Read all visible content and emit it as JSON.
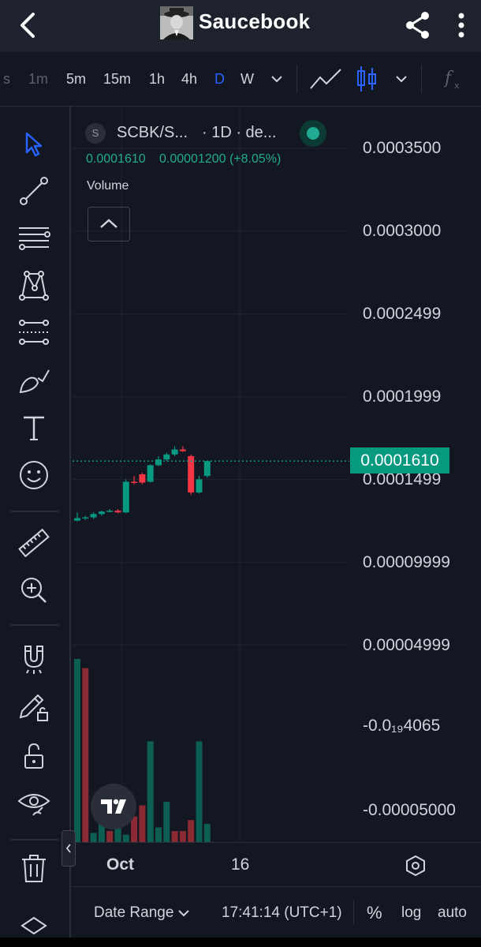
{
  "header": {
    "title": "Saucebook"
  },
  "timeframes": {
    "partial": "s",
    "items": [
      "1m",
      "5m",
      "15m",
      "1h",
      "4h",
      "D",
      "W"
    ],
    "active": "D"
  },
  "legend": {
    "symbol_initial": "S",
    "symbol": "SCBK/S...",
    "interval": "· 1D · de...",
    "price": "0.0001610",
    "change": "0.00001200 (+8.05%)",
    "volume_label": "Volume"
  },
  "price_axis": {
    "labels": [
      "0.0003500",
      "0.0003000",
      "0.0002499",
      "0.0001999",
      "0.0001499",
      "0.00009999",
      "0.00004999",
      "-0.0₁₉4065",
      "-0.00005000"
    ],
    "last_price": "0.0001610"
  },
  "time_axis": {
    "labels": [
      "Oct",
      "16"
    ]
  },
  "bottom_bar": {
    "date_range": "Date Range",
    "time": "17:41:14 (UTC+1)",
    "percent": "%",
    "log": "log",
    "auto": "auto"
  },
  "colors": {
    "up": "#089981",
    "down": "#f23645",
    "accent": "#2962ff",
    "background": "#131722"
  },
  "chart_data": {
    "type": "candlestick",
    "interval": "1D",
    "y_axis_ticks": [
      0.00035,
      0.0003,
      0.0002499,
      0.0001999,
      0.0001499,
      9.999e-05,
      4.999e-05
    ],
    "last_price": 0.000161,
    "candles": [
      {
        "o": 0.000125,
        "h": 0.00013,
        "l": 0.0001245,
        "c": 0.0001265
      },
      {
        "o": 0.0001265,
        "h": 0.000128,
        "l": 0.0001255,
        "c": 0.000127
      },
      {
        "o": 0.000127,
        "h": 0.00013,
        "l": 0.000126,
        "c": 0.000129
      },
      {
        "o": 0.000129,
        "h": 0.000131,
        "l": 0.000128,
        "c": 0.0001305
      },
      {
        "o": 0.0001305,
        "h": 0.000132,
        "l": 0.00013,
        "c": 0.000131
      },
      {
        "o": 0.000131,
        "h": 0.000132,
        "l": 0.0001295,
        "c": 0.00013
      },
      {
        "o": 0.00013,
        "h": 0.00015,
        "l": 0.0001295,
        "c": 0.0001485
      },
      {
        "o": 0.0001485,
        "h": 0.000152,
        "l": 0.000147,
        "c": 0.000148
      },
      {
        "o": 0.000153,
        "h": 0.000154,
        "l": 0.000147,
        "c": 0.000148
      },
      {
        "o": 0.0001485,
        "h": 0.000159,
        "l": 0.000148,
        "c": 0.0001585
      },
      {
        "o": 0.0001585,
        "h": 0.000164,
        "l": 0.000158,
        "c": 0.000162
      },
      {
        "o": 0.000162,
        "h": 0.000166,
        "l": 0.000161,
        "c": 0.000165
      },
      {
        "o": 0.000165,
        "h": 0.00017,
        "l": 0.000164,
        "c": 0.000168
      },
      {
        "o": 0.000168,
        "h": 0.00017,
        "l": 0.0001665,
        "c": 0.000167
      },
      {
        "o": 0.000164,
        "h": 0.000165,
        "l": 0.0001405,
        "c": 0.000142
      },
      {
        "o": 0.000142,
        "h": 0.000152,
        "l": 0.0001415,
        "c": 0.00015
      },
      {
        "o": 0.000152,
        "h": 0.000161,
        "l": 0.000151,
        "c": 0.000161
      }
    ],
    "volume": [
      {
        "v": 1.0,
        "dir": "up"
      },
      {
        "v": 0.95,
        "dir": "down"
      },
      {
        "v": 0.05,
        "dir": "up"
      },
      {
        "v": 0.12,
        "dir": "up"
      },
      {
        "v": 0.06,
        "dir": "down"
      },
      {
        "v": 0.08,
        "dir": "up"
      },
      {
        "v": 0.04,
        "dir": "up"
      },
      {
        "v": 0.14,
        "dir": "down"
      },
      {
        "v": 0.2,
        "dir": "down"
      },
      {
        "v": 0.55,
        "dir": "up"
      },
      {
        "v": 0.08,
        "dir": "up"
      },
      {
        "v": 0.22,
        "dir": "up"
      },
      {
        "v": 0.06,
        "dir": "down"
      },
      {
        "v": 0.06,
        "dir": "down"
      },
      {
        "v": 0.12,
        "dir": "down"
      },
      {
        "v": 0.55,
        "dir": "up"
      },
      {
        "v": 0.1,
        "dir": "up"
      }
    ]
  }
}
